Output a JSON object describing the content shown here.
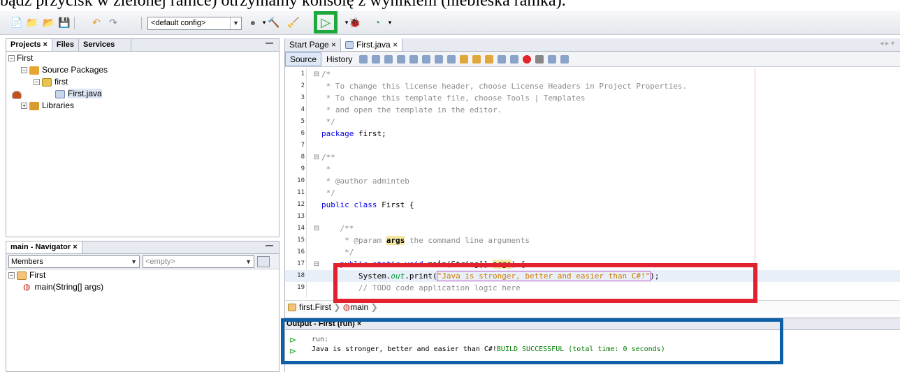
{
  "caption": "bądź przycisk w zielonej ramce) otrzymamy konsolę z wynikiem (niebieska ramka).",
  "toolbar": {
    "config_value": "<default config>",
    "icons": [
      "new-file-icon",
      "new-project-icon",
      "open-project-icon",
      "save-all-icon",
      "undo-icon",
      "redo-icon",
      "globe-icon",
      "hammer-icon",
      "clean-build-icon",
      "run-icon",
      "debug-icon",
      "profile-icon"
    ]
  },
  "projects_panel": {
    "tabs": [
      "Projects",
      "Files",
      "Services"
    ],
    "tree": [
      {
        "label": "First",
        "icon": "project-icon",
        "level": 0,
        "expanded": true
      },
      {
        "label": "Source Packages",
        "icon": "source-packages-icon",
        "level": 1,
        "expanded": true
      },
      {
        "label": "first",
        "icon": "package-icon",
        "level": 2,
        "expanded": true
      },
      {
        "label": "First.java",
        "icon": "java-file-icon",
        "level": 3
      },
      {
        "label": "Libraries",
        "icon": "libraries-icon",
        "level": 1,
        "expanded": false
      }
    ]
  },
  "navigator_panel": {
    "title": "main - Navigator",
    "members_label": "Members",
    "filter_value": "<empty>",
    "tree": [
      {
        "label": "First",
        "icon": "class-icon"
      },
      {
        "label": "main(String[] args)",
        "icon": "method-icon"
      }
    ]
  },
  "editor": {
    "tabs": [
      "Start Page",
      "First.java"
    ],
    "source_label": "Source",
    "history_label": "History",
    "lines": [
      {
        "n": "1",
        "fold": "⊟",
        "text": "/*"
      },
      {
        "n": "2",
        "fold": "",
        "text": " * To change this license header, choose License Headers in Project Properties."
      },
      {
        "n": "3",
        "fold": "",
        "text": " * To change this template file, choose Tools | Templates"
      },
      {
        "n": "4",
        "fold": "",
        "text": " * and open the template in the editor."
      },
      {
        "n": "5",
        "fold": "",
        "text": " */"
      },
      {
        "n": "6",
        "fold": "",
        "text": "package first;"
      },
      {
        "n": "7",
        "fold": "",
        "text": ""
      },
      {
        "n": "8",
        "fold": "⊟",
        "text": "/**"
      },
      {
        "n": "9",
        "fold": "",
        "text": " *"
      },
      {
        "n": "10",
        "fold": "",
        "text": " * @author adminteb"
      },
      {
        "n": "11",
        "fold": "",
        "text": " */"
      },
      {
        "n": "12",
        "fold": "",
        "text": "public class First {"
      },
      {
        "n": "13",
        "fold": "",
        "text": ""
      },
      {
        "n": "14",
        "fold": "⊟",
        "text": "    /**"
      },
      {
        "n": "15",
        "fold": "",
        "text": "     * @param args the command line arguments"
      },
      {
        "n": "16",
        "fold": "",
        "text": "     */"
      },
      {
        "n": "17",
        "fold": "⊟",
        "text": "    public static void main(String[] args) {"
      },
      {
        "n": "18",
        "fold": "",
        "text": "        System.out.print(\"Java is stronger, better and easier than C#!\");"
      },
      {
        "n": "19",
        "fold": "",
        "text": "        // TODO code application logic here"
      }
    ],
    "breadcrumb": [
      "first.First",
      "main"
    ]
  },
  "output": {
    "tab_label": "Output - First (run)",
    "lines": [
      "run:",
      "Java is stronger, better and easier than C#!BUILD SUCCESSFUL (total time: 0 seconds)"
    ]
  },
  "colors": {
    "green_frame": "#1fa83b",
    "red_frame": "#e3202d",
    "blue_frame": "#0d5fa8",
    "comment": "#8c8c8c",
    "keyword": "#0000e6",
    "string": "#ce7b00",
    "build_success": "#007a00"
  }
}
